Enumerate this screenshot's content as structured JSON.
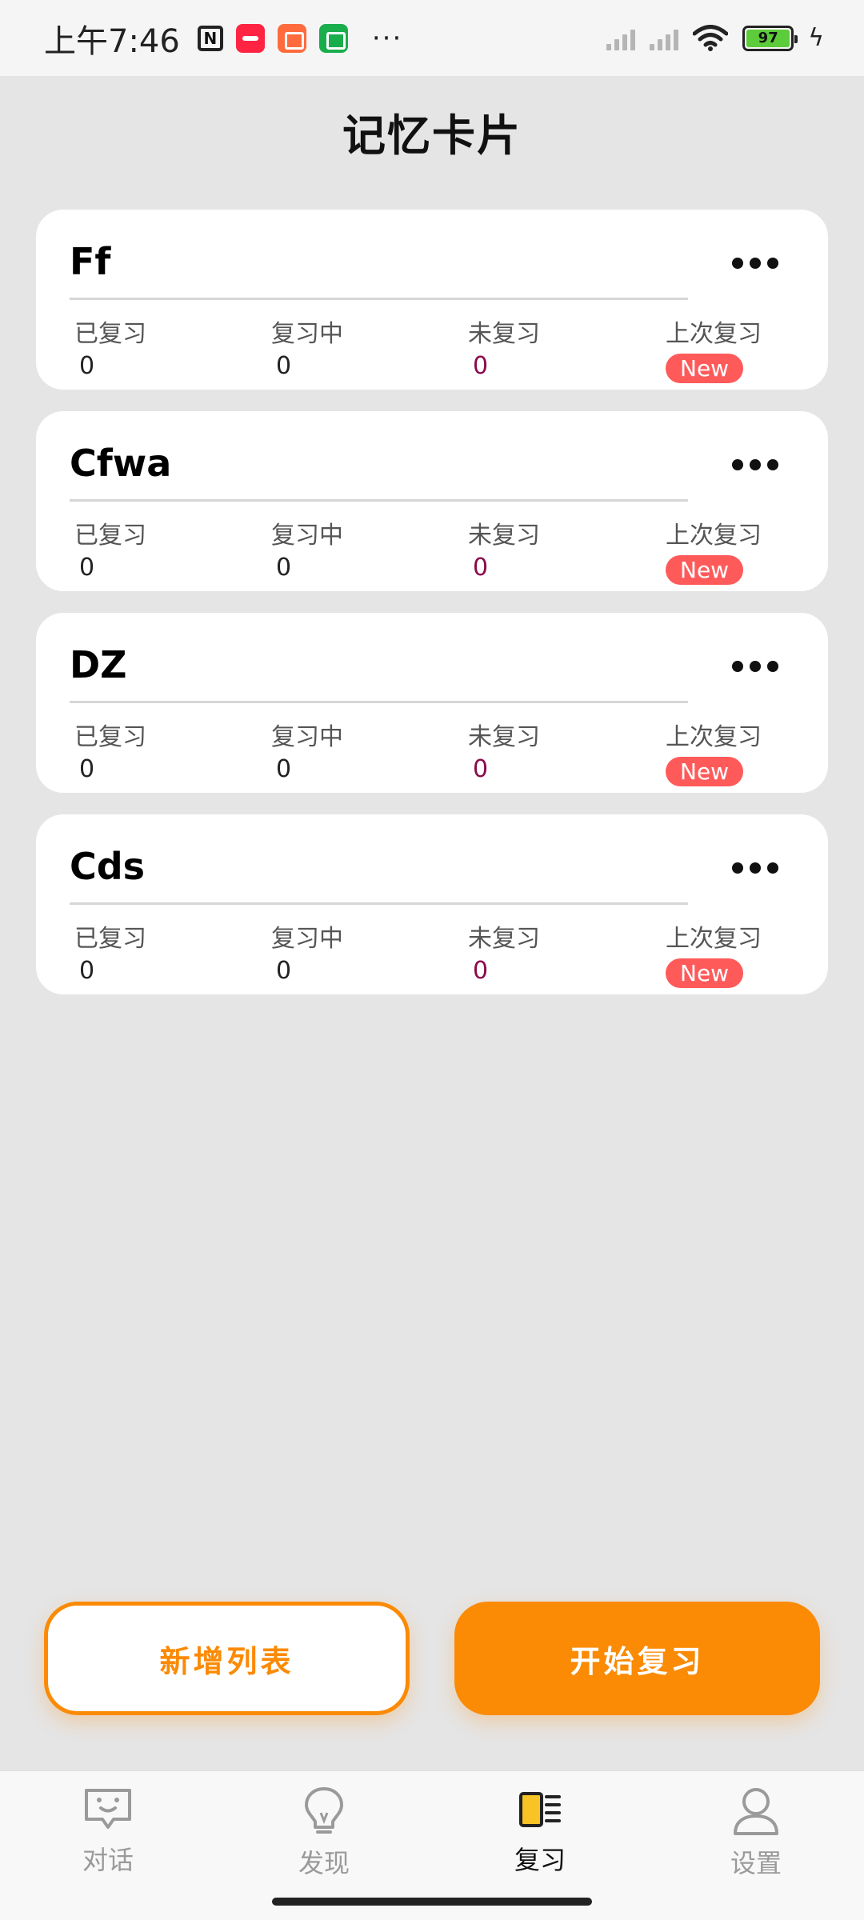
{
  "status_bar": {
    "time": "上午7:46",
    "battery": "97",
    "icons": [
      "nfc-icon",
      "xiaohongshu-app-icon",
      "orange-app-icon",
      "green-app-icon",
      "more-dots-icon",
      "signal-icon",
      "wifi-icon",
      "battery-icon",
      "charging-icon"
    ]
  },
  "page": {
    "title": "记忆卡片"
  },
  "card_labels": {
    "reviewed": "已复习",
    "reviewing": "复习中",
    "unreviewed": "未复习",
    "last_review": "上次复习"
  },
  "cards": [
    {
      "title": "Ff",
      "reviewed": "0",
      "reviewing": "0",
      "unreviewed": "0",
      "last_review": "New"
    },
    {
      "title": "Cfwa",
      "reviewed": "0",
      "reviewing": "0",
      "unreviewed": "0",
      "last_review": "New"
    },
    {
      "title": "DZ",
      "reviewed": "0",
      "reviewing": "0",
      "unreviewed": "0",
      "last_review": "New"
    },
    {
      "title": "Cds",
      "reviewed": "0",
      "reviewing": "0",
      "unreviewed": "0",
      "last_review": "New"
    }
  ],
  "actions": {
    "add_list": "新增列表",
    "start_review": "开始复习"
  },
  "tabs": [
    {
      "label": "对话",
      "icon": "chat-icon",
      "active": false
    },
    {
      "label": "发现",
      "icon": "lightbulb-icon",
      "active": false
    },
    {
      "label": "复习",
      "icon": "review-card-icon",
      "active": true
    },
    {
      "label": "设置",
      "icon": "user-icon",
      "active": false
    }
  ],
  "colors": {
    "accent": "#fb8a04",
    "badge": "#ff5a5a",
    "unreviewed_value": "#8b0a4b",
    "background": "#e5e5e5"
  }
}
